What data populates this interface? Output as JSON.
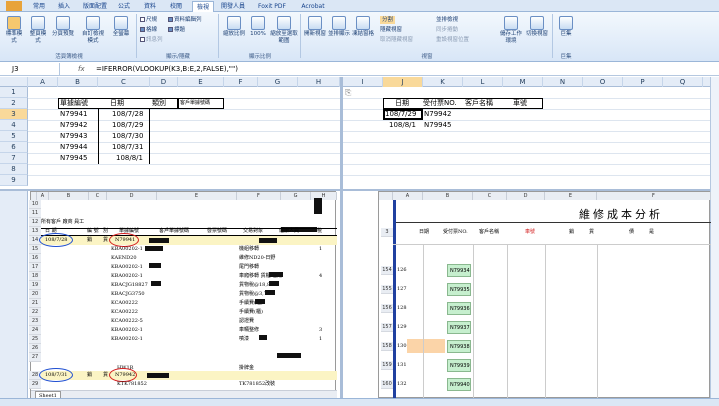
{
  "ribbon_tabs": [
    "常用",
    "插入",
    "版面配置",
    "公式",
    "資料",
    "校閱",
    "檢視",
    "開發人員",
    "Foxit PDF",
    "Acrobat"
  ],
  "ribbon": {
    "view_buttons": [
      "標準模式",
      "整頁模式",
      "分頁預覽",
      "自訂檢視模式",
      "全螢幕"
    ],
    "view_group": "活頁簿檢視",
    "show_items": [
      {
        "label": "尺規",
        "checked": false
      },
      {
        "label": "資料編輯列",
        "checked": true
      },
      {
        "label": "格線",
        "checked": true
      },
      {
        "label": "標題",
        "checked": true
      },
      {
        "label": "訊息列",
        "checked": false
      }
    ],
    "show_group": "顯示/隱藏",
    "zoom_buttons": [
      "縮放比例",
      "100%",
      "縮放至選取範圍"
    ],
    "zoom_group": "顯示比例",
    "window_buttons": [
      "開新視窗",
      "並排顯示",
      "凍結窗格"
    ],
    "window_small": [
      "分割",
      "隱藏視窗",
      "取消隱藏視窗",
      "並排檢視",
      "同步捲動",
      "重設視窗位置"
    ],
    "workspace": "儲存工作環境",
    "switch": "切換視窗",
    "window_group": "視窗",
    "macro": "巨集",
    "macro_group": "巨集"
  },
  "formula_bar": {
    "cell": "J3",
    "fx": "fx",
    "formula": "=IFERROR(VLOOKUP(K3,B:E,2,FALSE),\"\")"
  },
  "left_pane": {
    "columns": [
      "A",
      "B",
      "C",
      "D",
      "E",
      "F",
      "G",
      "H"
    ],
    "rows": [
      "1",
      "2",
      "3",
      "4",
      "5",
      "6",
      "7",
      "8",
      "9"
    ],
    "headers": [
      "單據編號",
      "日期",
      "類別",
      "客戶單據號碼"
    ],
    "data": [
      [
        "N79941",
        "108/7/28"
      ],
      [
        "N79942",
        "108/7/29"
      ],
      [
        "N79943",
        "108/7/30"
      ],
      [
        "N79944",
        "108/7/31"
      ],
      [
        "N79945",
        "108/8/1"
      ]
    ]
  },
  "right_pane": {
    "columns": [
      "I",
      "J",
      "K",
      "L",
      "M",
      "N",
      "O",
      "P",
      "Q"
    ],
    "rows": [
      "1",
      "2",
      "3",
      "4",
      "5",
      "6",
      "7",
      "8",
      "9"
    ],
    "headers": [
      "日期",
      "受付票NO.",
      "客戶名稱",
      "車號"
    ],
    "data": [
      [
        "108/7/29",
        "N79942"
      ],
      [
        "108/8/1",
        "N79945"
      ]
    ]
  },
  "left_image": {
    "cols": [
      "A",
      "B",
      "C",
      "D",
      "E",
      "F",
      "G",
      "H"
    ],
    "rows": [
      "10",
      "11",
      "12",
      "13",
      "14",
      "15",
      "16",
      "17",
      "18",
      "19",
      "20",
      "21",
      "22",
      "23",
      "24",
      "25",
      "26",
      "27",
      "28",
      "29"
    ],
    "title": "所有客戶 廠商 員工",
    "header_cells": [
      "日 期",
      "編 號",
      "別",
      "單據編號",
      "客戶單據號碼",
      "發票號碼",
      "交易對象",
      "經辦人員",
      "稅"
    ],
    "row15": [
      "108/7/28",
      "銷",
      "貨",
      "N79941"
    ],
    "items": [
      "KBA00202-1",
      "KAEND20",
      "KBA00202-1",
      "KBA00202-1",
      "KBACJG18827",
      "KBACJG3750",
      "KCA00222",
      "KCA00222",
      "KCA00222-5",
      "KBA00202-1",
      "KBA00202-1",
      "HW1R"
    ],
    "objects": [
      "機組移轉",
      "維修ND20-日野",
      "尾門移轉",
      "車廂移轉 貨櫃 包角",
      "貨物稅@18,827",
      "貨物稅@3,750",
      "手續費(櫃)",
      "手續費(櫃)",
      "認證費",
      "車輛整修",
      "噴漆",
      "掛牌金"
    ],
    "nums": [
      "1",
      "",
      "",
      "4",
      "",
      "",
      "",
      "",
      "",
      "3",
      "1",
      ""
    ],
    "row28": [
      "108/7/31",
      "銷",
      "貨",
      "N79942"
    ],
    "row29": [
      "KTK781852",
      "TK781852改裝"
    ],
    "sheet_tab": "Sheet1"
  },
  "right_image": {
    "cols": [
      "A",
      "B",
      "C",
      "D",
      "E",
      "F"
    ],
    "title": "維修成本分析",
    "header_cells": [
      "日期",
      "受付票NO.",
      "客戶名稱",
      "車號",
      "銷",
      "貨",
      "",
      "債",
      "是"
    ],
    "rows": [
      {
        "r": "3",
        "n": ""
      },
      {
        "r": "154",
        "n": "126",
        "v": "N79934"
      },
      {
        "r": "155",
        "n": "127",
        "v": "N79935"
      },
      {
        "r": "156",
        "n": "128",
        "v": "N79936"
      },
      {
        "r": "157",
        "n": "129",
        "v": "N79937"
      },
      {
        "r": "158",
        "n": "130",
        "v": "N79938"
      },
      {
        "r": "159",
        "n": "131",
        "v": "N79939"
      },
      {
        "r": "160",
        "n": "132",
        "v": "N79940"
      },
      {
        "r": "161",
        "n": "133",
        "v": "N79941"
      },
      {
        "r": "162",
        "n": "134",
        "v": "N79942"
      },
      {
        "r": "163",
        "n": "135",
        "v": "N79943"
      }
    ]
  },
  "colors": {
    "accent": "#15428b",
    "selected": "#f9d99a",
    "green_cell": "#c6efce"
  }
}
